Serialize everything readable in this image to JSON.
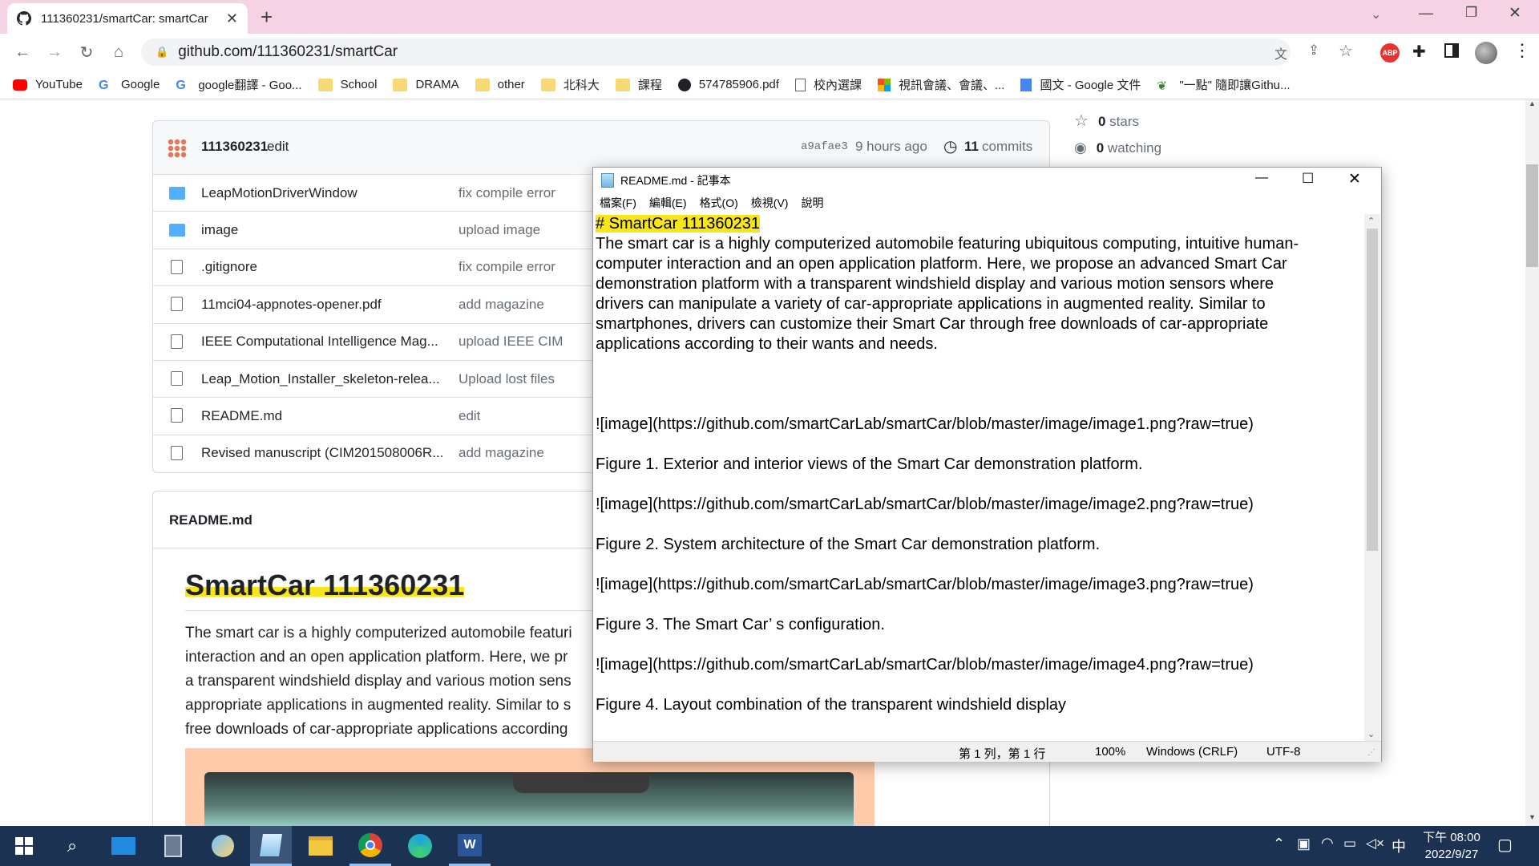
{
  "browser": {
    "tab_title": "111360231/smartCar: smartCar",
    "url": "github.com/111360231/smartCar",
    "bookmarks": [
      {
        "label": "YouTube",
        "icon": "youtube-icon"
      },
      {
        "label": "Google",
        "icon": "google-icon"
      },
      {
        "label": "google翻譯 - Goo...",
        "icon": "google-icon"
      },
      {
        "label": "School",
        "icon": "folder-icon"
      },
      {
        "label": "DRAMA",
        "icon": "folder-icon"
      },
      {
        "label": "other",
        "icon": "folder-icon"
      },
      {
        "label": "北科大",
        "icon": "folder-icon"
      },
      {
        "label": "課程",
        "icon": "folder-icon"
      },
      {
        "label": "574785906.pdf",
        "icon": "globe-icon"
      },
      {
        "label": "校內選課",
        "icon": "page-icon"
      },
      {
        "label": "視訊會議、會議、...",
        "icon": "microsoft-icon"
      },
      {
        "label": "國文 - Google 文件",
        "icon": "docs-icon"
      },
      {
        "label": "\"一點\" 隨即讓Githu...",
        "icon": "leaf-icon"
      }
    ],
    "ext_badge": "ABP"
  },
  "repo": {
    "commit_author": "111360231",
    "commit_msg": "edit",
    "commit_hash": "a9afae3",
    "commit_time": "9 hours ago",
    "commit_count": "11",
    "commits_label": "commits",
    "files": [
      {
        "name": "LeapMotionDriverWindow",
        "msg": "fix compile error",
        "type": "folder"
      },
      {
        "name": "image",
        "msg": "upload image",
        "type": "folder"
      },
      {
        "name": ".gitignore",
        "msg": "fix compile error",
        "type": "file"
      },
      {
        "name": "11mci04-appnotes-opener.pdf",
        "msg": "add magazine",
        "type": "file"
      },
      {
        "name": "IEEE Computational Intelligence Mag...",
        "msg": "upload IEEE CIM",
        "type": "file"
      },
      {
        "name": "Leap_Motion_Installer_skeleton-relea...",
        "msg": "Upload lost files",
        "type": "file"
      },
      {
        "name": "README.md",
        "msg": "edit",
        "type": "file"
      },
      {
        "name": "Revised manuscript (CIM201508006R...",
        "msg": "add magazine",
        "type": "file"
      }
    ],
    "readme_label": "README.md",
    "readme_heading": "SmartCar 111360231",
    "readme_lines": [
      "The smart car is a highly computerized automobile featuri",
      "interaction and an open application platform. Here, we pr",
      "a transparent windshield display and various motion sens",
      "appropriate applications in augmented reality. Similar to s",
      "free downloads of car-appropriate applications according"
    ],
    "stars": "0",
    "stars_label": "stars",
    "watching": "0",
    "watching_label": "watching"
  },
  "notepad": {
    "title": "README.md - 記事本",
    "menu": [
      "檔案(F)",
      "編輯(E)",
      "格式(O)",
      "檢視(V)",
      "說明"
    ],
    "heading": "# SmartCar 111360231",
    "body": "The smart car is a highly computerized automobile featuring ubiquitous computing, intuitive human-\ncomputer interaction and an open application platform. Here, we propose an advanced Smart Car\ndemonstration platform with a transparent windshield display and various motion sensors where\ndrivers can manipulate a variety of car-appropriate applications in augmented reality. Similar to\nsmartphones, drivers can customize their Smart Car through free downloads of car-appropriate\napplications according to their wants and needs.\n\n\n\n![image](https://github.com/smartCarLab/smartCar/blob/master/image/image1.png?raw=true)\n\nFigure 1. Exterior and interior views of the Smart Car demonstration platform.\n\n![image](https://github.com/smartCarLab/smartCar/blob/master/image/image2.png?raw=true)\n\nFigure 2. System architecture of the Smart Car demonstration platform.\n\n![image](https://github.com/smartCarLab/smartCar/blob/master/image/image3.png?raw=true)\n\nFigure 3. The Smart Car’ s configuration.\n\n![image](https://github.com/smartCarLab/smartCar/blob/master/image/image4.png?raw=true)\n\nFigure 4. Layout combination of the transparent windshield display",
    "status_pos": "第 1 列，第 1 行",
    "status_zoom": "100%",
    "status_eol": "Windows (CRLF)",
    "status_enc": "UTF-8"
  },
  "taskbar": {
    "ime": "中",
    "time": "下午 08:00",
    "date": "2022/9/27"
  },
  "colors": {
    "highlight": "#f7e51a",
    "tabbar": "#f6d3e4",
    "taskbar": "#1c3252",
    "link": "#0969da"
  }
}
